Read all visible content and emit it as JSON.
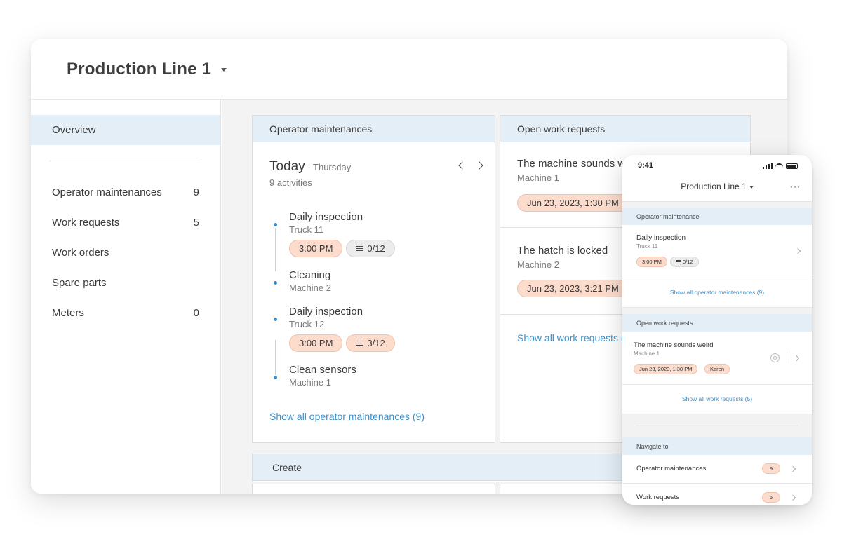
{
  "desktop": {
    "title": "Production Line 1",
    "sidebar": {
      "active": "Overview",
      "items": [
        {
          "label": "Operator maintenances",
          "count": "9"
        },
        {
          "label": "Work requests",
          "count": "5"
        },
        {
          "label": "Work orders",
          "count": ""
        },
        {
          "label": "Spare parts",
          "count": ""
        },
        {
          "label": "Meters",
          "count": "0"
        }
      ]
    },
    "operator_panel": {
      "header": "Operator maintenances",
      "day": "Today",
      "weekday": " - Thursday",
      "activities": "9 activities",
      "items": [
        {
          "title": "Daily inspection",
          "sub": "Truck 11",
          "time": "3:00 PM",
          "progress": "0/12"
        },
        {
          "title": "Cleaning",
          "sub": "Machine 2"
        },
        {
          "title": "Daily inspection",
          "sub": "Truck 12",
          "time": "3:00 PM",
          "progress": "3/12"
        },
        {
          "title": "Clean sensors",
          "sub": "Machine 1"
        }
      ],
      "show_all": "Show all operator maintenances (9)"
    },
    "work_panel": {
      "header": "Open work requests",
      "items": [
        {
          "title": "The machine sounds w",
          "sub": "Machine 1",
          "date": "Jun 23, 2023, 1:30 PM"
        },
        {
          "title": "The hatch is locked",
          "sub": "Machine 2",
          "date": "Jun 23, 2023, 3:21 PM"
        }
      ],
      "show_all": "Show all work requests ("
    },
    "create_panel": {
      "header": "Create"
    }
  },
  "phone": {
    "time": "9:41",
    "title": "Production Line 1",
    "more": "···",
    "operator_section": "Operator maintenance",
    "operator_item": {
      "title": "Daily inspection",
      "sub": "Truck 11",
      "time": "3:00 PM",
      "progress": "0/12"
    },
    "operator_show_all": "Show all operator maintenances (9)",
    "work_section": "Open work requests",
    "work_item": {
      "title": "The machine sounds weird",
      "sub": "Machine 1",
      "date": "Jun 23, 2023, 1:30 PM",
      "assignee": "Karen"
    },
    "work_show_all": "Show all work requests (5)",
    "nav_section": "Navigate to",
    "nav_items": [
      {
        "label": "Operator maintenances",
        "count": "9"
      },
      {
        "label": "Work requests",
        "count": "5"
      }
    ]
  },
  "colors": {
    "accent": "#3f8fc6",
    "header_bg": "#e3eef6",
    "chip_orange": "#fbdccd"
  }
}
